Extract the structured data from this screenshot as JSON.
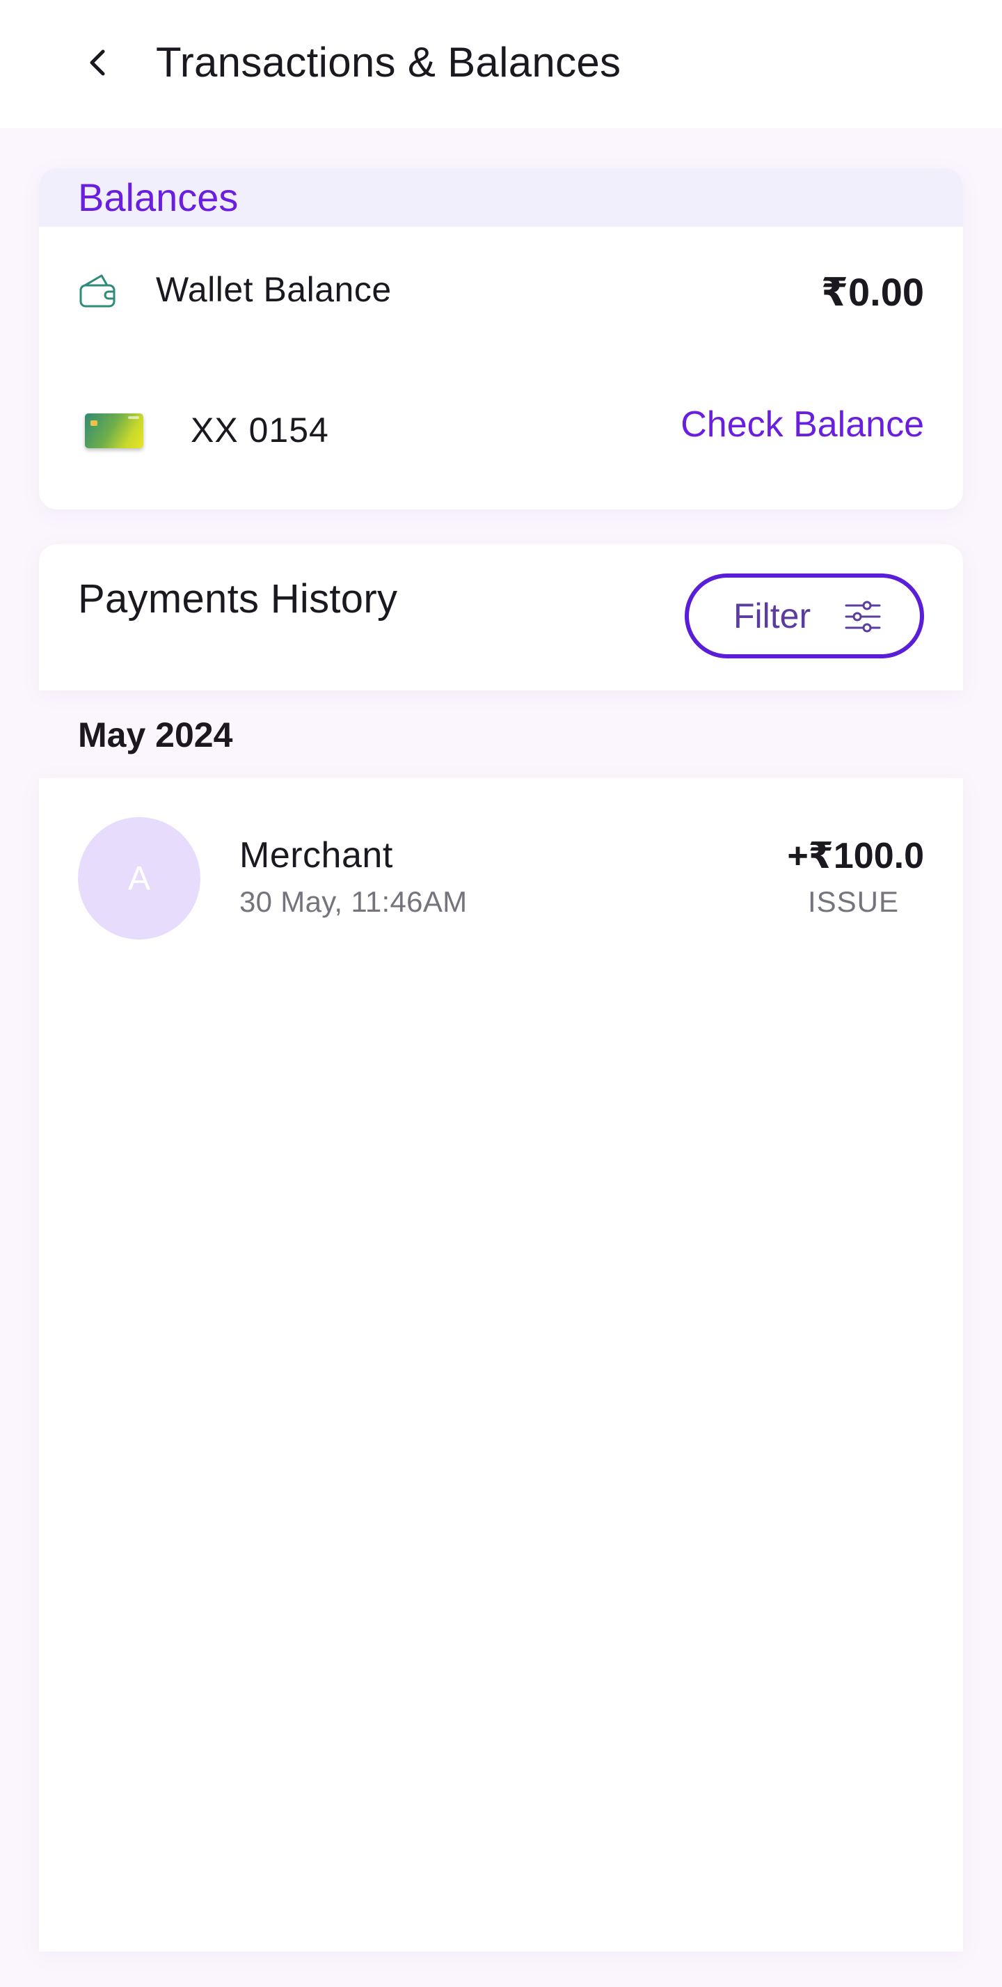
{
  "header": {
    "title": "Transactions & Balances",
    "back_icon": "arrow-left-icon"
  },
  "balances": {
    "title": "Balances",
    "wallet": {
      "icon": "wallet-icon",
      "label": "Wallet Balance",
      "amount": "₹0.00"
    },
    "card": {
      "icon": "card-thumbnail",
      "number": "XX 0154",
      "action_label": "Check Balance"
    }
  },
  "history": {
    "title": "Payments History",
    "filter_label": "Filter",
    "filter_icon": "sliders-icon",
    "groups": [
      {
        "month": "May 2024",
        "transactions": [
          {
            "avatar_initial": "A",
            "name": "Merchant",
            "datetime": "30 May, 11:46AM",
            "amount": "+₹100.0",
            "status": "ISSUE"
          }
        ]
      }
    ]
  },
  "colors": {
    "accent": "#6a1ee0",
    "filter_border": "#5b1ed8",
    "page_bg": "#fbf6fd",
    "balances_header_bg": "#f2effd",
    "wallet_icon": "#2e8b78",
    "avatar_bg": "#e8dcfc",
    "muted_text": "#76737c"
  }
}
